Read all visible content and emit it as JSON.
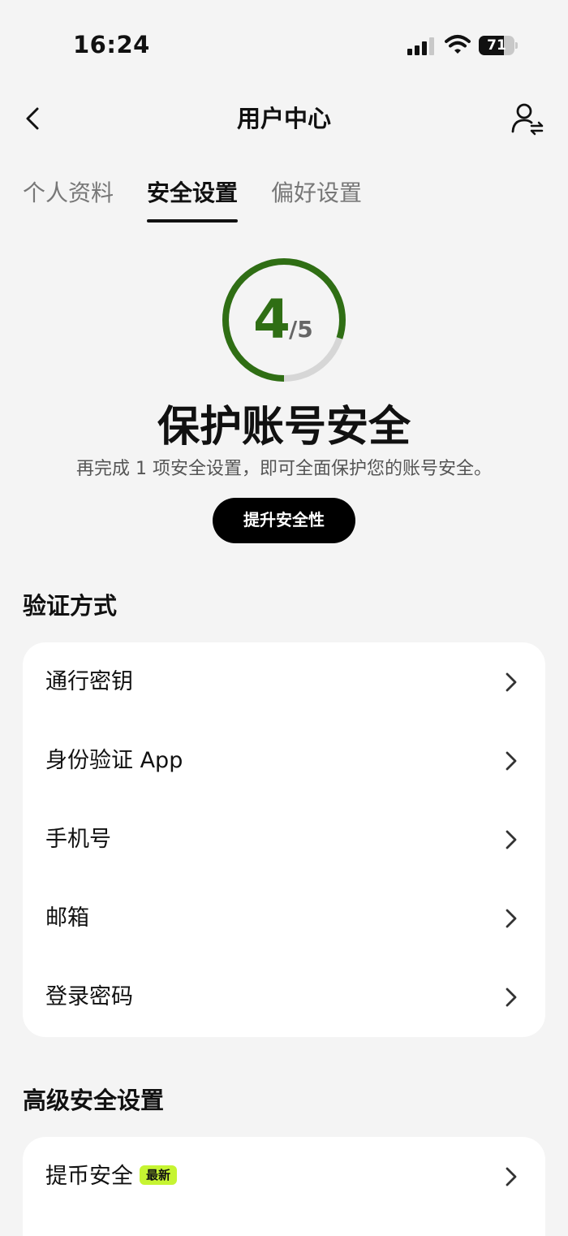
{
  "status_bar": {
    "time": "16:24",
    "battery_level": "71",
    "battery_fraction": 0.71
  },
  "nav": {
    "title": "用户中心",
    "back_icon": "chevron-left-icon",
    "right_icon": "switch-user-icon"
  },
  "tabs": [
    {
      "label": "个人资料",
      "active": false
    },
    {
      "label": "安全设置",
      "active": true
    },
    {
      "label": "偏好设置",
      "active": false
    }
  ],
  "security_score": {
    "value": "4",
    "total": "/5",
    "progress": 0.8,
    "color": "#2f6e14",
    "track_color": "#d6d6d6"
  },
  "hero": {
    "title": "保护账号安全",
    "subtitle": "再完成 1 项安全设置，即可全面保护您的账号安全。",
    "button": "提升安全性"
  },
  "verification": {
    "title": "验证方式",
    "items": [
      {
        "label": "通行密钥"
      },
      {
        "label": "身份验证 App"
      },
      {
        "label": "手机号"
      },
      {
        "label": "邮箱"
      },
      {
        "label": "登录密码"
      }
    ]
  },
  "advanced": {
    "title": "高级安全设置",
    "items": [
      {
        "label": "提币安全",
        "badge": "最新",
        "badge_color": "#c6f432"
      }
    ]
  }
}
